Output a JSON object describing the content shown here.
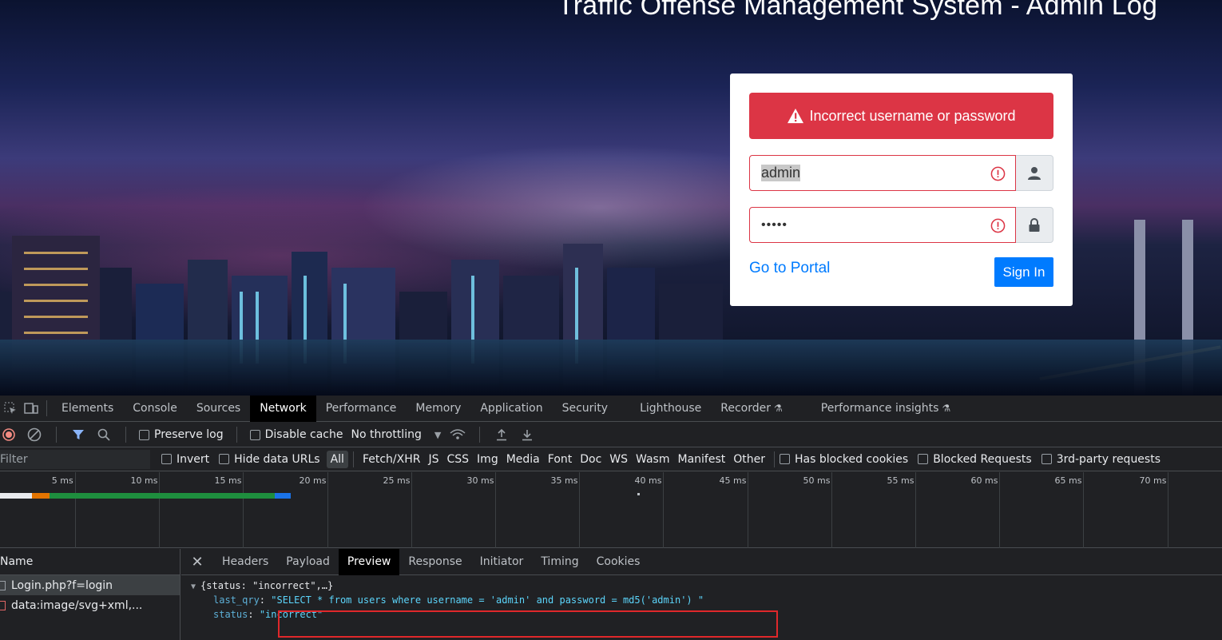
{
  "page": {
    "title": "Traffic Offense Management System - Admin Log",
    "alert": "Incorrect username or password",
    "username_value": "admin",
    "password_value": "•••••",
    "portal_link": "Go to Portal",
    "signin": "Sign In"
  },
  "devtools": {
    "tabs": [
      "Elements",
      "Console",
      "Sources",
      "Network",
      "Performance",
      "Memory",
      "Application",
      "Security",
      "Lighthouse",
      "Recorder",
      "Performance insights"
    ],
    "active_tab": "Network",
    "toolbar": {
      "preserve_log": "Preserve log",
      "disable_cache": "Disable cache",
      "throttling": "No throttling"
    },
    "filter": {
      "placeholder": "Filter",
      "invert": "Invert",
      "hide_data_urls": "Hide data URLs",
      "types": [
        "All",
        "Fetch/XHR",
        "JS",
        "CSS",
        "Img",
        "Media",
        "Font",
        "Doc",
        "WS",
        "Wasm",
        "Manifest",
        "Other"
      ],
      "has_blocked_cookies": "Has blocked cookies",
      "blocked_requests": "Blocked Requests",
      "third_party": "3rd-party requests"
    },
    "timeline_ticks": [
      "5 ms",
      "10 ms",
      "15 ms",
      "20 ms",
      "25 ms",
      "30 ms",
      "35 ms",
      "40 ms",
      "45 ms",
      "50 ms",
      "55 ms",
      "60 ms",
      "65 ms",
      "70 ms"
    ],
    "requests": {
      "header": "Name",
      "rows": [
        "Login.php?f=login",
        "data:image/svg+xml,..."
      ]
    },
    "detail_tabs": [
      "Headers",
      "Payload",
      "Preview",
      "Response",
      "Initiator",
      "Timing",
      "Cookies"
    ],
    "active_detail_tab": "Preview",
    "preview": {
      "summary": "{status: \"incorrect\",…}",
      "last_qry_key": "last_qry",
      "last_qry_value": "\"SELECT * from users where username = 'admin' and password = md5('admin') \"",
      "status_key": "status",
      "status_value": "\"incorrect\""
    }
  }
}
